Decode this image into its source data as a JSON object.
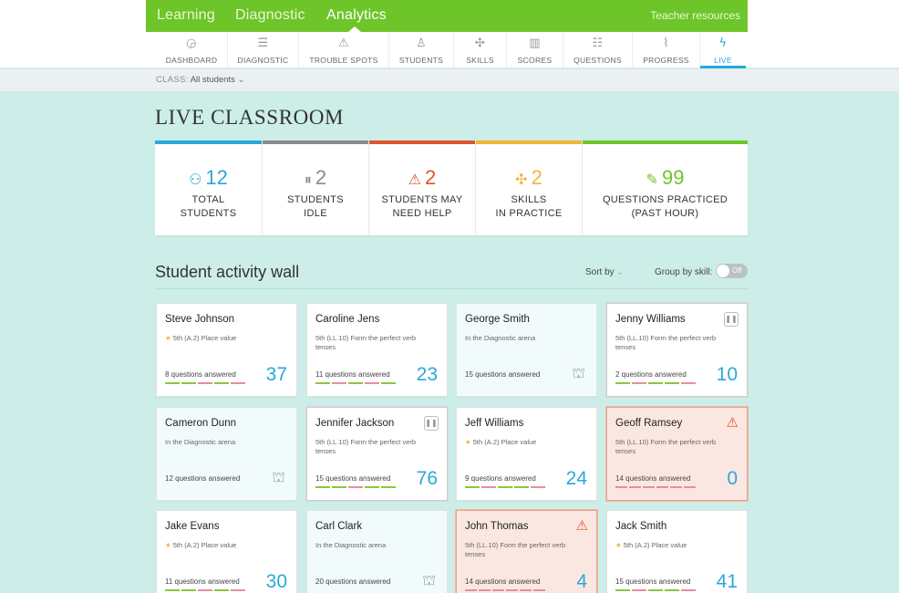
{
  "topnav": {
    "items": [
      "Learning",
      "Diagnostic",
      "Analytics"
    ],
    "active": "Analytics",
    "teacher_resources": "Teacher resources"
  },
  "subnav": [
    {
      "label": "DASHBOARD",
      "icon": "dashboard-icon",
      "glyph": "◶"
    },
    {
      "label": "DIAGNOSTIC",
      "icon": "sliders-icon",
      "glyph": "☰"
    },
    {
      "label": "TROUBLE SPOTS",
      "icon": "warning-icon",
      "glyph": "⚠"
    },
    {
      "label": "STUDENTS",
      "icon": "students-icon",
      "glyph": "♙"
    },
    {
      "label": "SKILLS",
      "icon": "puzzle-icon",
      "glyph": "✣"
    },
    {
      "label": "SCORES",
      "icon": "scores-icon",
      "glyph": "▥"
    },
    {
      "label": "QUESTIONS",
      "icon": "questions-icon",
      "glyph": "☷"
    },
    {
      "label": "PROGRESS",
      "icon": "progress-icon",
      "glyph": "⌇"
    },
    {
      "label": "LIVE",
      "icon": "live-icon",
      "glyph": "ϟ"
    }
  ],
  "class_filter": {
    "key": "CLASS:",
    "value": "All students",
    "chevron": "⌄"
  },
  "page_title": "LIVE CLASSROOM",
  "stats": [
    {
      "value": "12",
      "label1": "TOTAL",
      "label2": "STUDENTS",
      "color": "#2aa8d8",
      "icon": "students-icon",
      "glyph": "⚇"
    },
    {
      "value": "2",
      "label1": "STUDENTS",
      "label2": "IDLE",
      "color": "#8a8a8a",
      "icon": "pause-icon",
      "glyph": "⏸"
    },
    {
      "value": "2",
      "label1": "STUDENTS MAY",
      "label2": "NEED HELP",
      "color": "#e0552b",
      "icon": "warning-icon",
      "glyph": "⚠"
    },
    {
      "value": "2",
      "label1": "SKILLS",
      "label2": "IN PRACTICE",
      "color": "#f2b632",
      "icon": "puzzle-icon",
      "glyph": "✣"
    },
    {
      "value": "99",
      "label1": "QUESTIONS PRACTICED",
      "label2": "(PAST HOUR)",
      "color": "#6ec52a",
      "icon": "pencil-icon",
      "glyph": "✎"
    }
  ],
  "wall": {
    "title": "Student activity wall",
    "sort_by": "Sort by",
    "group_by": "Group by skill:",
    "toggle": "Off"
  },
  "cards": [
    {
      "name": "Steve Johnson",
      "skill": "5th (A.2) Place value",
      "star": true,
      "qa": "8 questions answered",
      "score": "37",
      "state": "normal"
    },
    {
      "name": "Caroline Jens",
      "skill": "5th (LL.10) Form the perfect verb tenses",
      "star": false,
      "qa": "11 questions answered",
      "score": "23",
      "state": "normal"
    },
    {
      "name": "George Smith",
      "skill": "In the Diagnostic arena",
      "star": false,
      "qa": "15 questions answered",
      "score": "",
      "state": "diag"
    },
    {
      "name": "Jenny Williams",
      "skill": "5th (LL.10) Form the perfect verb tenses",
      "star": false,
      "qa": "2 questions answered",
      "score": "10",
      "state": "idle"
    },
    {
      "name": "Cameron Dunn",
      "skill": "In the Diagnostic arena",
      "star": false,
      "qa": "12 questions answered",
      "score": "",
      "state": "diag"
    },
    {
      "name": "Jennifer Jackson",
      "skill": "5th (LL.10) Form the perfect verb tenses",
      "star": false,
      "qa": "15 questions answered",
      "score": "76",
      "state": "idle"
    },
    {
      "name": "Jeff Williams",
      "skill": "5th (A.2) Place value",
      "star": true,
      "qa": "9 questions answered",
      "score": "24",
      "state": "normal"
    },
    {
      "name": "Geoff Ramsey",
      "skill": "5th (LL.10) Form the perfect verb tenses",
      "star": false,
      "qa": "14 questions answered",
      "score": "0",
      "state": "alert"
    },
    {
      "name": "Jake Evans",
      "skill": "5th (A.2) Place value",
      "star": true,
      "qa": "11 questions answered",
      "score": "30",
      "state": "normal"
    },
    {
      "name": "Carl Clark",
      "skill": "In the Diagnostic arena",
      "star": false,
      "qa": "20 questions answered",
      "score": "",
      "state": "diag"
    },
    {
      "name": "John Thomas",
      "skill": "5th (LL.10) Form the perfect verb tenses",
      "star": false,
      "qa": "14 questions answered",
      "score": "4",
      "state": "alert"
    },
    {
      "name": "Jack Smith",
      "skill": "5th (A.2) Place value",
      "star": true,
      "qa": "15 questions answered",
      "score": "41",
      "state": "normal"
    }
  ],
  "colors": {
    "green": "#6ec52a",
    "blue": "#2aa8d8",
    "red": "#e0552b",
    "yellow": "#f2b632",
    "grey": "#8a8a8a"
  }
}
